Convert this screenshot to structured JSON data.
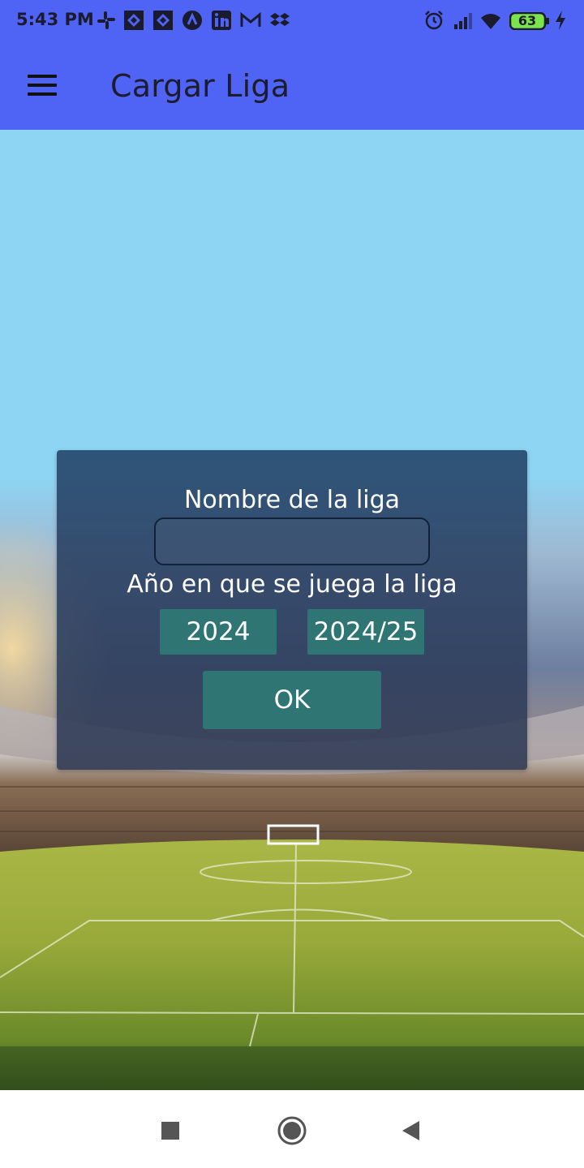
{
  "status_bar": {
    "time": "5:43 PM",
    "notification_icons": [
      "slack-icon",
      "jira-icon",
      "jira-icon",
      "arc-icon",
      "linkedin-icon",
      "gmail-icon",
      "dropbox-icon"
    ],
    "system_icons": [
      "alarm-icon",
      "signal-icon",
      "wifi-icon",
      "battery-icon",
      "charging-icon"
    ],
    "battery_level": "63"
  },
  "app_bar": {
    "title": "Cargar Liga",
    "menu_icon": "hamburger-menu-icon"
  },
  "dialog": {
    "name_label": "Nombre de la liga",
    "name_value": "",
    "year_label": "Año en que se juega la liga",
    "year_single": "2024",
    "year_season": "2024/25",
    "ok_label": "OK"
  },
  "nav_bar": {
    "buttons": [
      "recents-square-icon",
      "home-circle-icon",
      "back-triangle-icon"
    ]
  },
  "colors": {
    "app_bar": "#4f63f4",
    "sky": "#8ed5f4",
    "dialog_button": "#2e7573",
    "nav_bar": "#ffffff"
  }
}
